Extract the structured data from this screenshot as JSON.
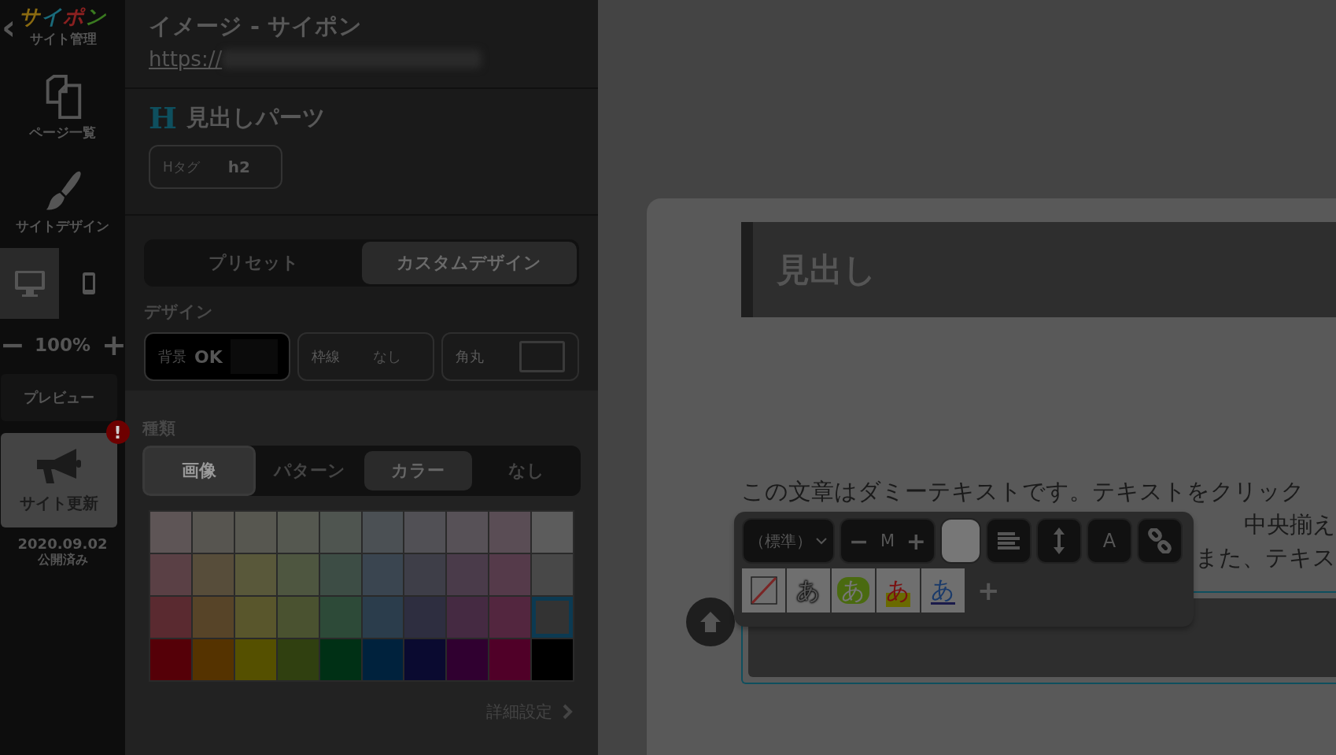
{
  "sidebar": {
    "back": "‹",
    "logo": [
      {
        "char": "サ",
        "color": "#8a6a10"
      },
      {
        "char": "イ",
        "color": "#1a6a7a"
      },
      {
        "char": "ポ",
        "color": "#8a2020"
      },
      {
        "char": "ン",
        "color": "#3a7a20"
      }
    ],
    "site_label": "サイト管理",
    "nav": [
      {
        "kind": "pages",
        "label": "ページ一覧"
      },
      {
        "kind": "design",
        "label": "サイトデザイン"
      }
    ],
    "devices": [
      {
        "kind": "desktop",
        "selected": true
      },
      {
        "kind": "mobile",
        "selected": false
      }
    ],
    "zoom": {
      "minus": "−",
      "value": "100%",
      "plus": "+"
    },
    "preview": "プレビュー",
    "update": {
      "label": "サイト更新",
      "alert": "!",
      "date": "2020.09.02",
      "status": "公開済み"
    }
  },
  "panel": {
    "title": "イメージ - サイポン",
    "url": "https://",
    "part": {
      "icon": "H",
      "title": "見出しパーツ"
    },
    "htag": {
      "label": "Hタグ",
      "value": "h2"
    },
    "modes": [
      {
        "label": "プリセット",
        "selected": false
      },
      {
        "label": "カスタムデザイン",
        "selected": true
      }
    ],
    "design_label": "デザイン",
    "design": [
      {
        "kind": "background",
        "label": "背景",
        "value": "OK"
      },
      {
        "kind": "border",
        "label": "枠線",
        "value": "なし"
      },
      {
        "kind": "radius",
        "label": "角丸"
      }
    ],
    "type_label": "種類",
    "types": [
      {
        "label": "画像",
        "selected": true,
        "hovered": false
      },
      {
        "label": "パターン",
        "selected": false,
        "hovered": false
      },
      {
        "label": "カラー",
        "selected": false,
        "hovered": true
      },
      {
        "label": "なし",
        "selected": false,
        "hovered": false
      }
    ],
    "swatches": [
      {
        "color": "#5e5556",
        "selected": false
      },
      {
        "color": "#575550",
        "selected": false
      },
      {
        "color": "#575750",
        "selected": false
      },
      {
        "color": "#555850",
        "selected": false
      },
      {
        "color": "#4f5550",
        "selected": false
      },
      {
        "color": "#4b5054",
        "selected": false
      },
      {
        "color": "#515055",
        "selected": false
      },
      {
        "color": "#575157",
        "selected": false
      },
      {
        "color": "#5a4d55",
        "selected": false
      },
      {
        "color": "#5c5c5c",
        "selected": false
      },
      {
        "color": "#5a4045",
        "selected": false
      },
      {
        "color": "#574d3a",
        "selected": false
      },
      {
        "color": "#59583a",
        "selected": false
      },
      {
        "color": "#4e5640",
        "selected": false
      },
      {
        "color": "#3d4d45",
        "selected": false
      },
      {
        "color": "#3a4550",
        "selected": false
      },
      {
        "color": "#3e3e48",
        "selected": false
      },
      {
        "color": "#4a3b4a",
        "selected": false
      },
      {
        "color": "#553a4a",
        "selected": false
      },
      {
        "color": "#484848",
        "selected": false
      },
      {
        "color": "#5a2a30",
        "selected": false
      },
      {
        "color": "#574428",
        "selected": false
      },
      {
        "color": "#59562c",
        "selected": false
      },
      {
        "color": "#4a5230",
        "selected": false
      },
      {
        "color": "#2d4a38",
        "selected": false
      },
      {
        "color": "#2b3d4c",
        "selected": false
      },
      {
        "color": "#2e2e40",
        "selected": false
      },
      {
        "color": "#452a42",
        "selected": false
      },
      {
        "color": "#53263f",
        "selected": false
      },
      {
        "color": "#333333",
        "selected": true
      },
      {
        "color": "#550008",
        "selected": false
      },
      {
        "color": "#553300",
        "selected": false
      },
      {
        "color": "#555000",
        "selected": false
      },
      {
        "color": "#304010",
        "selected": false
      },
      {
        "color": "#003015",
        "selected": false
      },
      {
        "color": "#00223d",
        "selected": false
      },
      {
        "color": "#0a0a30",
        "selected": false
      },
      {
        "color": "#300030",
        "selected": false
      },
      {
        "color": "#500028",
        "selected": false
      },
      {
        "color": "#000000",
        "selected": false
      }
    ],
    "details": "詳細設定"
  },
  "preview": {
    "heading": "見出し",
    "line": "この文章はダミーテキストです。テキストをクリック",
    "covered_lines": [
      "中央揃え",
      "また、テキス"
    ]
  },
  "toolbar": {
    "font": "（標準）",
    "size": {
      "minus": "−",
      "value": "M",
      "plus": "+"
    },
    "tools": [
      {
        "kind": "align"
      },
      {
        "kind": "height"
      },
      {
        "kind": "text",
        "label": "A"
      },
      {
        "kind": "link"
      }
    ],
    "styles": [
      {
        "kind": "none"
      },
      {
        "kind": "outline",
        "label": "あ"
      },
      {
        "kind": "badge",
        "label": "あ"
      },
      {
        "kind": "marker",
        "label": "あ"
      },
      {
        "kind": "underline",
        "label": "あ"
      }
    ],
    "add": "+"
  }
}
